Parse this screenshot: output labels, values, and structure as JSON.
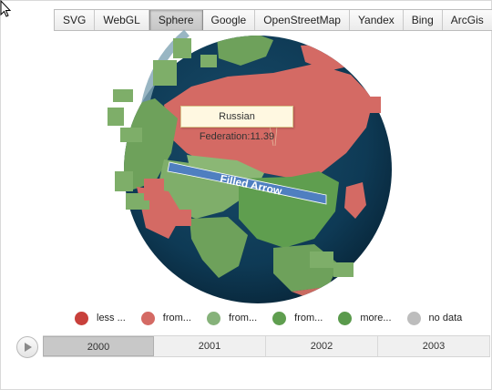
{
  "toolbar": {
    "buttons": [
      {
        "label": "SVG"
      },
      {
        "label": "WebGL"
      },
      {
        "label": "Sphere"
      },
      {
        "label": "Google"
      },
      {
        "label": "OpenStreetMap"
      },
      {
        "label": "Yandex"
      },
      {
        "label": "Bing"
      },
      {
        "label": "ArcGis"
      }
    ],
    "active": "Sphere"
  },
  "map": {
    "tooltip": "Russian Federation:11.39",
    "arrow_label": "Filled Arrow",
    "colors": {
      "ocean": "#0e3a55",
      "russia": "#d46a64",
      "land_green": "#6ea15b",
      "land_green_light": "#8bb775",
      "arrow": "#4f7fc0"
    }
  },
  "legend": {
    "items": [
      {
        "label": "less ...",
        "color": "#c8403b"
      },
      {
        "label": "from...",
        "color": "#d46a64"
      },
      {
        "label": "from...",
        "color": "#86b27a"
      },
      {
        "label": "from...",
        "color": "#5f9e4f"
      },
      {
        "label": "more...",
        "color": "#5a9a4c"
      },
      {
        "label": "no data",
        "color": "#bdbdbd"
      }
    ]
  },
  "timeline": {
    "ticks": [
      {
        "label": "2000"
      },
      {
        "label": "2001"
      },
      {
        "label": "2002"
      },
      {
        "label": "2003"
      }
    ],
    "selected": "2000"
  }
}
